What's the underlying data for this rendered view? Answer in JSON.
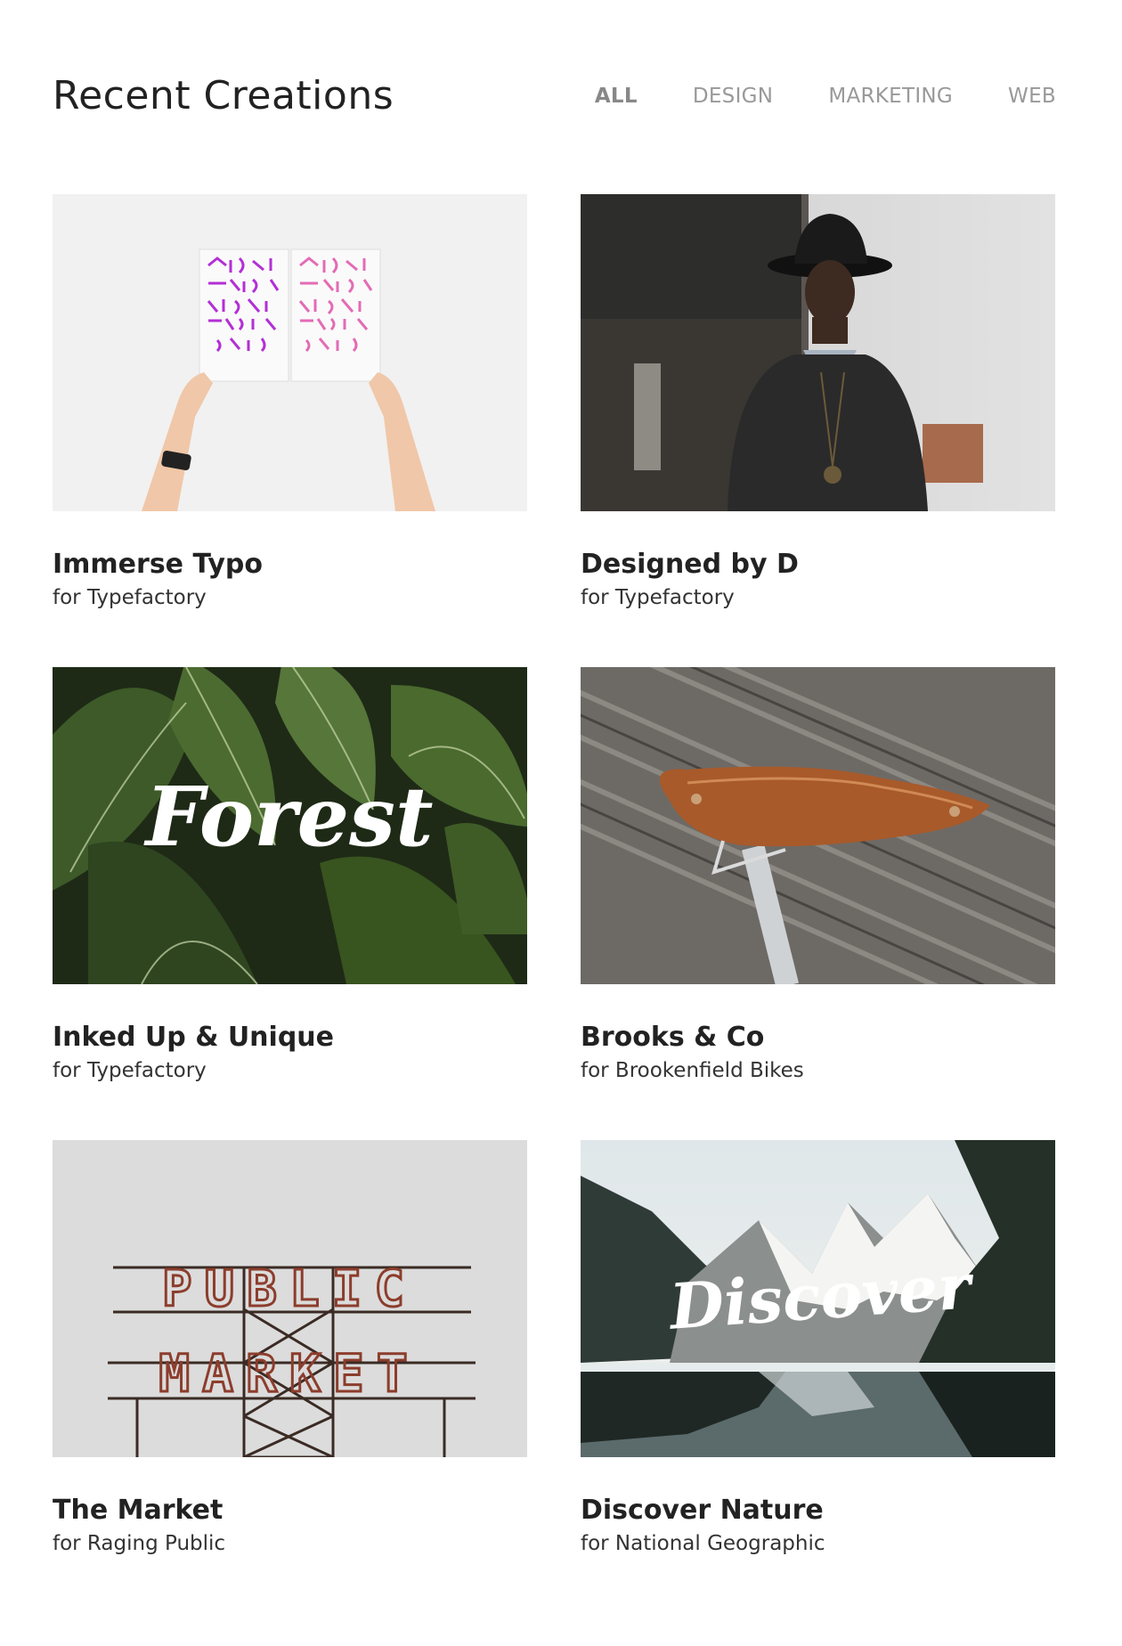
{
  "header": {
    "title": "Recent Creations",
    "filters": [
      {
        "label": "ALL",
        "active": true
      },
      {
        "label": "DESIGN",
        "active": false
      },
      {
        "label": "MARKETING",
        "active": false
      },
      {
        "label": "WEB",
        "active": false
      }
    ]
  },
  "projects": [
    {
      "title": "Immerse Typo",
      "client": "for Typefactory",
      "image": "hands-holding-typography-prints"
    },
    {
      "title": "Designed by D",
      "client": "for Typefactory",
      "image": "man-in-black-hat"
    },
    {
      "title": "Inked Up & Unique",
      "client": "for Typefactory",
      "image": "forest-leaves",
      "image_text": "Forest"
    },
    {
      "title": "Brooks & Co",
      "client": "for Brookenfield Bikes",
      "image": "leather-bike-saddle"
    },
    {
      "title": "The Market",
      "client": "for Raging Public",
      "image": "public-market-sign",
      "image_text_1": "PUBLIC",
      "image_text_2": "MARKET"
    },
    {
      "title": "Discover Nature",
      "client": "for National Geographic",
      "image": "mountain-lake",
      "image_text": "Discover"
    }
  ]
}
